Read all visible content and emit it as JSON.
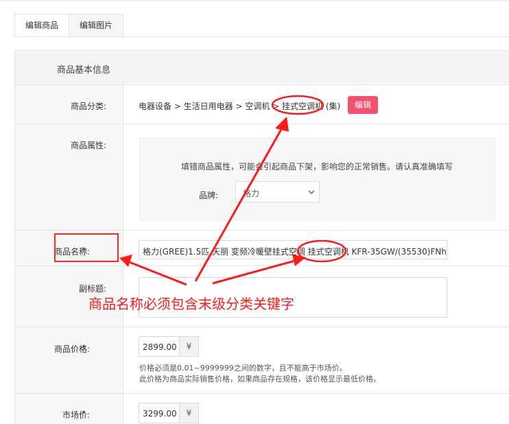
{
  "tabs": [
    {
      "label": "编辑商品",
      "active": true
    },
    {
      "label": "编辑图片",
      "active": false
    }
  ],
  "section_title": "商品基本信息",
  "category": {
    "label": "商品分类:",
    "path": "电器设备 > 生活日用电器 > 空调机 > 挂式空调机 (集)",
    "edit_label": "编辑"
  },
  "attributes": {
    "label": "商品属性:",
    "tip": "填错商品属性，可能会引起商品下架，影响您的正常销售。请认真准确填写",
    "brand_label": "品牌:",
    "brand_value": "格力"
  },
  "name": {
    "label": "商品名称:",
    "required_mark": "*",
    "value": "格力(GREE)1.5匹 天丽 变频冷暖壁挂式空调 挂式空调机 KFR-35GW/(35530)FNh"
  },
  "subtitle": {
    "label": "副标题:",
    "value": ""
  },
  "price": {
    "label": "商品价格:",
    "required_mark": "*",
    "value": "2899.00",
    "unit": "¥",
    "hint_1": "价格必须是0.01~9999999之间的数字，且不能高于市场价。",
    "hint_2": "此价格为商品实际销售价格，如果商品存在规格，该价格显示最低价格。"
  },
  "market_price": {
    "label": "市场价:",
    "required_mark": "*",
    "value": "3299.00",
    "unit": "¥"
  },
  "annotation_text": "商品名称必须包含末级分类关键字",
  "colors": {
    "accent_pink": "#f5516f",
    "annotation_red": "#ff1a1a",
    "required_red": "#e4393c"
  }
}
